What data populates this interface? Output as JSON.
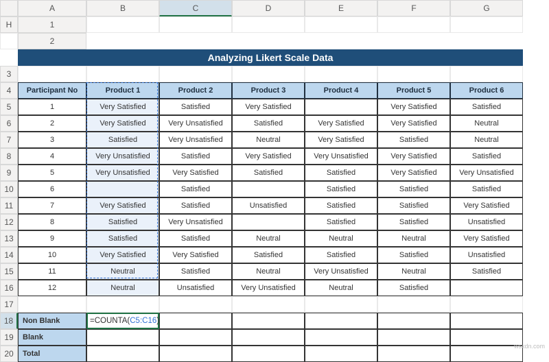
{
  "columns": [
    "A",
    "B",
    "C",
    "D",
    "E",
    "F",
    "G",
    "H"
  ],
  "rows": [
    "1",
    "2",
    "3",
    "4",
    "5",
    "6",
    "7",
    "8",
    "9",
    "10",
    "11",
    "12",
    "13",
    "14",
    "15",
    "16",
    "17",
    "18",
    "19",
    "20"
  ],
  "title": "Analyzing Likert Scale Data",
  "headers": [
    "Participant No",
    "Product 1",
    "Product 2",
    "Product 3",
    "Product 4",
    "Product 5",
    "Product 6"
  ],
  "data": [
    [
      "1",
      "Very Satisfied",
      "Satisfied",
      "Very Satisfied",
      "",
      "Very Satisfied",
      "Satisfied"
    ],
    [
      "2",
      "Very Satisfied",
      "Very Unsatisfied",
      "Satisfied",
      "Very Satisfied",
      "Very Satisfied",
      "Neutral"
    ],
    [
      "3",
      "Satisfied",
      "Very Unsatisfied",
      "Neutral",
      "Very Satisfied",
      "Satisfied",
      "Neutral"
    ],
    [
      "4",
      "Very Unsatisfied",
      "Satisfied",
      "Very Satisfied",
      "Very Unsatisfied",
      "Very Satisfied",
      "Satisfied"
    ],
    [
      "5",
      "Very Unsatisfied",
      "Very Satisfied",
      "Satisfied",
      "Satisfied",
      "Very Satisfied",
      "Very Unsatisfied"
    ],
    [
      "6",
      "",
      "Satisfied",
      "",
      "Satisfied",
      "Satisfied",
      "Satisfied"
    ],
    [
      "7",
      "Very Satisfied",
      "Satisfied",
      "Unsatisfied",
      "Satisfied",
      "Satisfied",
      "Very Satisfied"
    ],
    [
      "8",
      "Satisfied",
      "Very Unsatisfied",
      "",
      "Satisfied",
      "Satisfied",
      "Unsatisfied"
    ],
    [
      "9",
      "Satisfied",
      "Satisfied",
      "Neutral",
      "Neutral",
      "Neutral",
      "Very Satisfied"
    ],
    [
      "10",
      "Very Satisfied",
      "Very Satisfied",
      "Satisfied",
      "Satisfied",
      "Satisfied",
      "Unsatisfied"
    ],
    [
      "11",
      "Neutral",
      "Satisfied",
      "Neutral",
      "Very Unsatisfied",
      "Neutral",
      "Satisfied"
    ],
    [
      "12",
      "Neutral",
      "Unsatisfied",
      "Very Unsatisfied",
      "Neutral",
      "Satisfied",
      ""
    ]
  ],
  "summary": [
    "Non Blank",
    "Blank",
    "Total"
  ],
  "formula_prefix": "=COUNTA(",
  "formula_ref": "C5:C16",
  "formula_suffix": ")",
  "watermark": "wsxdn.com",
  "selected_col": "C",
  "selected_row": "18"
}
